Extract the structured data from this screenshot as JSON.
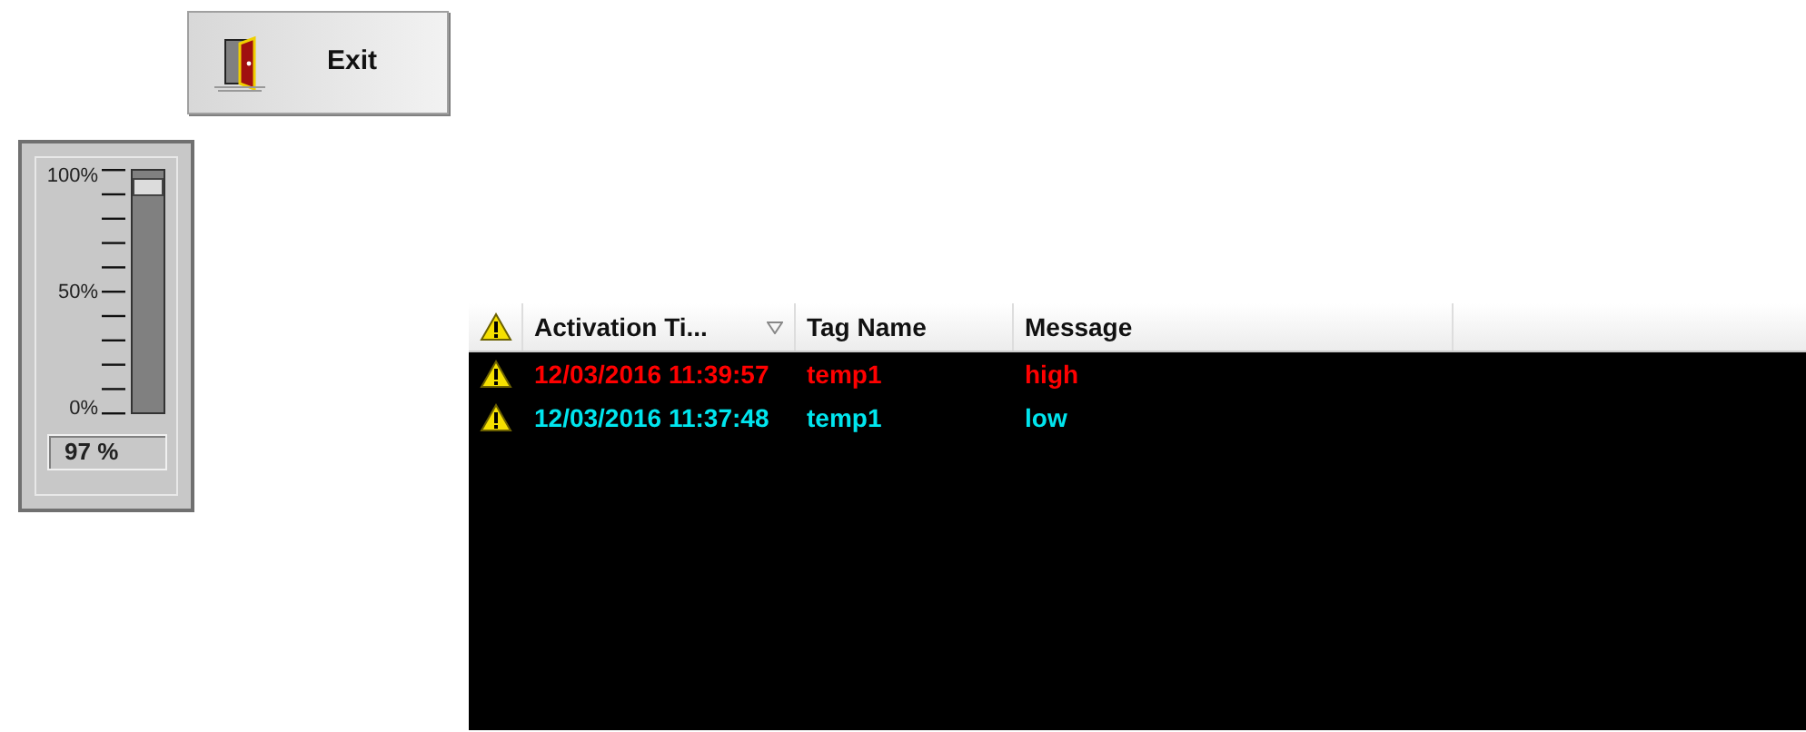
{
  "exit_button": {
    "label": "Exit"
  },
  "slider": {
    "ticks": [
      "100%",
      "50%",
      "0%"
    ],
    "level": 0.97,
    "reading": "97 %"
  },
  "alarm_table": {
    "columns": [
      {
        "label": "Activation Ti...",
        "sorted": true
      },
      {
        "label": "Tag Name",
        "sorted": false
      },
      {
        "label": "Message",
        "sorted": false
      }
    ],
    "rows": [
      {
        "time": "12/03/2016 11:39:57",
        "tag": "temp1",
        "message": "high",
        "color": "#ff0000"
      },
      {
        "time": "12/03/2016 11:37:48",
        "tag": "temp1",
        "message": "low",
        "color": "#00e5ee"
      }
    ]
  }
}
